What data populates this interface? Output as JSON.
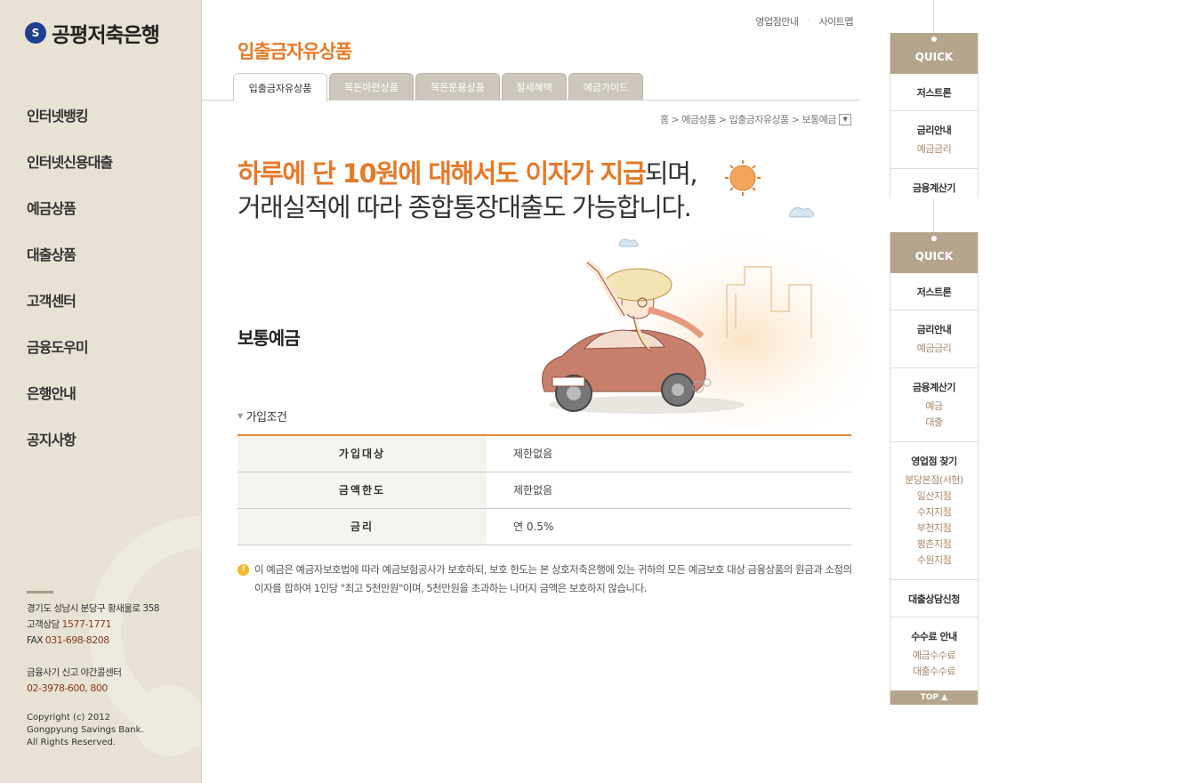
{
  "sidebar": {
    "logo_text": "공평저축은행",
    "nav": [
      "인터넷뱅킹",
      "인터넷신용대출",
      "예금상품",
      "대출상품",
      "고객센터",
      "금융도우미",
      "은행안내",
      "공지사항"
    ],
    "address": "경기도 성남시 분당구 황새울로 358",
    "phone_label": "고객상담",
    "phone": "1577-1771",
    "fax_label": "FAX",
    "fax": "031-698-8208",
    "fraud_label": "금융사기 신고 야간콜센터",
    "fraud_phone": "02-3978-600, 800",
    "copyright": [
      "Copyright (c) 2012",
      "Gongpyung Savings Bank.",
      "All Rights Reserved."
    ]
  },
  "util": {
    "branch": "영업점안내",
    "sitemap": "사이트맵"
  },
  "page_title": "입출금자유상품",
  "tabs": [
    "입출금자유상품",
    "목돈마련상품",
    "목돈운용상품",
    "절세혜택",
    "예금가이드"
  ],
  "active_tab": "입출금자유상품",
  "breadcrumb": "홈 > 예금상품 > 입출금자유상품 > 보통예금",
  "headline": {
    "highlight": "하루에 단 10원에 대해서도 이자가 지급",
    "rest1": "되며,",
    "line2": "거래실적에 따라 종합통장대출도 가능합니다."
  },
  "product_title": "보통예금",
  "conditions": {
    "title": "가입조건",
    "rows": [
      {
        "label": "가입대상",
        "value": "제한없음"
      },
      {
        "label": "금액한도",
        "value": "제한없음"
      },
      {
        "label": "금리",
        "value": "연 0.5%"
      }
    ]
  },
  "notice": {
    "icon": "!",
    "text": "이 예금은 예금자보호법에 따라 예금보험공사가 보호하되, 보호 한도는 본 상호저축은행에 있는 귀하의 모든 예금보호 대상 금융상품의 원금과 소정의 이자를 합하여 1인당 \"최고 5천만원\"이며, 5천만원을 초과하는 나머지 금액은 보호하지 않습니다."
  },
  "quick": {
    "label": "QUICK",
    "items": [
      {
        "title": "저스트론",
        "subs": []
      },
      {
        "title": "금리안내",
        "subs": [
          "예금금리"
        ]
      },
      {
        "title": "금융계산기",
        "subs": [
          "예금",
          "대출"
        ]
      },
      {
        "title": "영업점 찾기",
        "subs": [
          "분당본점(서현)",
          "일산지점",
          "수지지점",
          "부천지점",
          "평촌지점",
          "수원지점"
        ]
      },
      {
        "title": "대출상담신청",
        "subs": []
      },
      {
        "title": "수수료 안내",
        "subs": [
          "예금수수료",
          "대출수수료"
        ]
      }
    ],
    "top_label": "TOP ▲"
  },
  "colors": {
    "accent": "#e57a2a",
    "sidebar_bg": "#e8e2d4",
    "quick_head": "#b5a58d",
    "sub_link": "#a9876a"
  }
}
